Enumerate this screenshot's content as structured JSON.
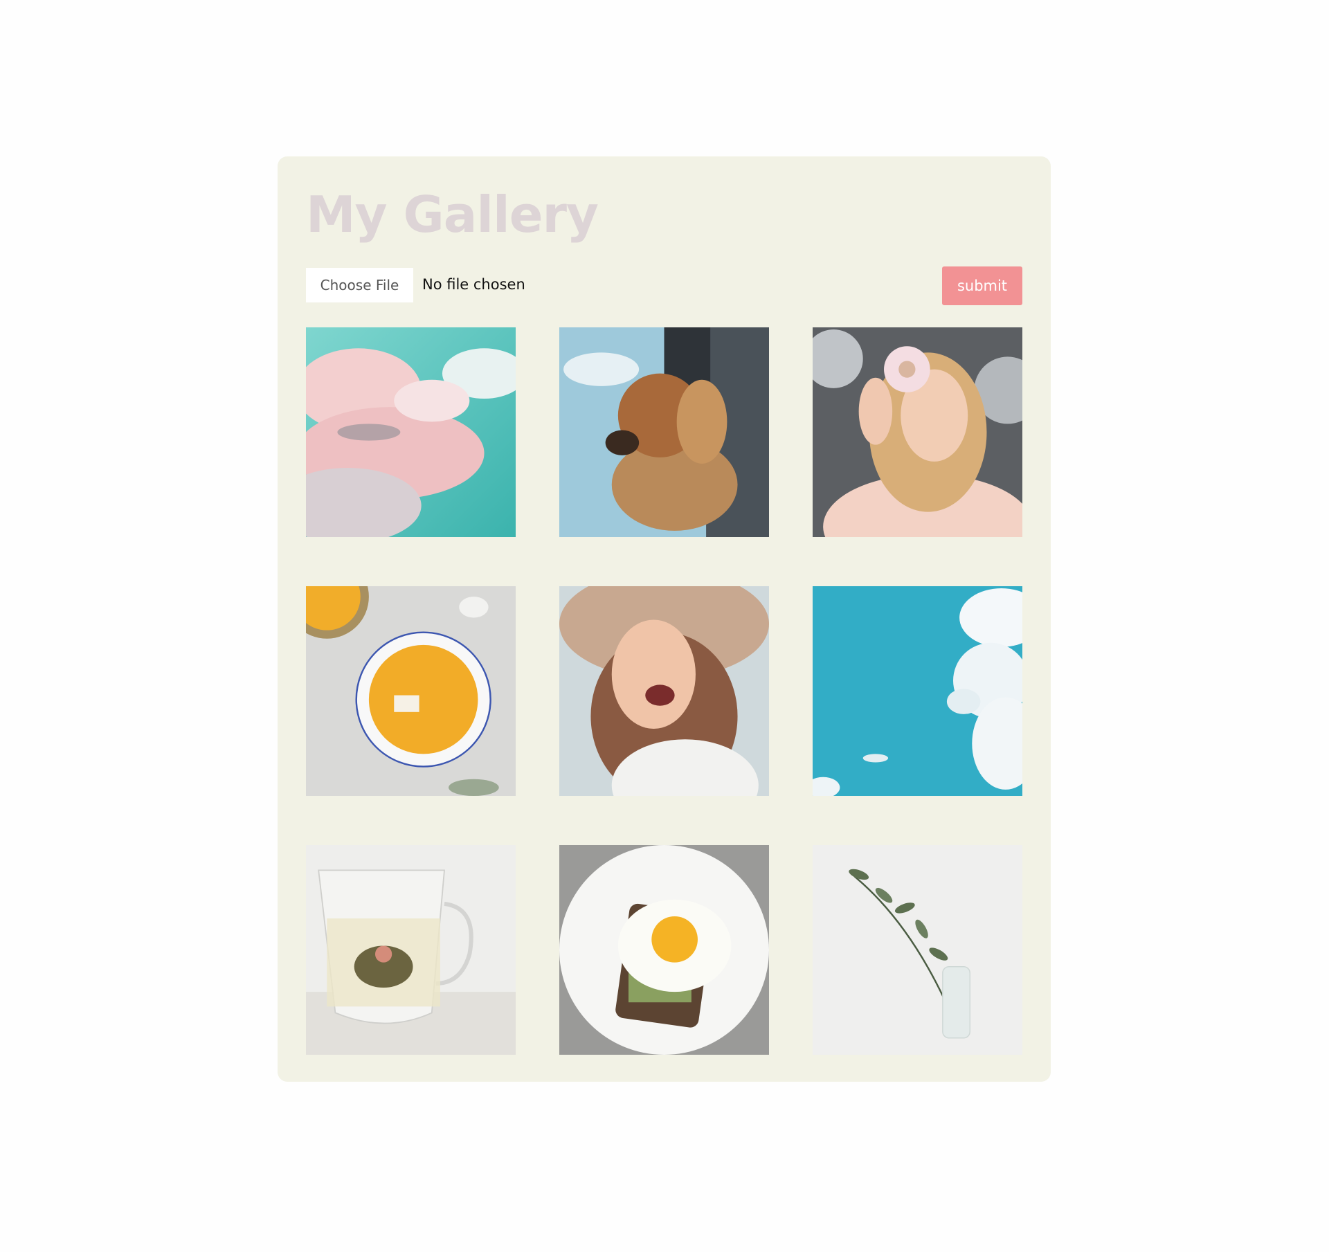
{
  "gallery": {
    "title": "My Gallery",
    "upload": {
      "choose_label": "Choose File",
      "status_text": "No file chosen",
      "submit_label": "submit"
    },
    "images": [
      {
        "icon": "cloudy-sky-image"
      },
      {
        "icon": "dog-in-car-window-image"
      },
      {
        "icon": "woman-with-donut-image"
      },
      {
        "icon": "pumpkin-soup-image"
      },
      {
        "icon": "laughing-woman-in-hat-image"
      },
      {
        "icon": "blue-sky-clouds-image"
      },
      {
        "icon": "flower-tea-cup-image"
      },
      {
        "icon": "egg-avocado-toast-image"
      },
      {
        "icon": "eucalyptus-vase-image"
      }
    ]
  },
  "colors": {
    "background": "#fefefe",
    "card": "#f2f2e5",
    "title": "#ddd4d6",
    "submit": "#f29294"
  }
}
